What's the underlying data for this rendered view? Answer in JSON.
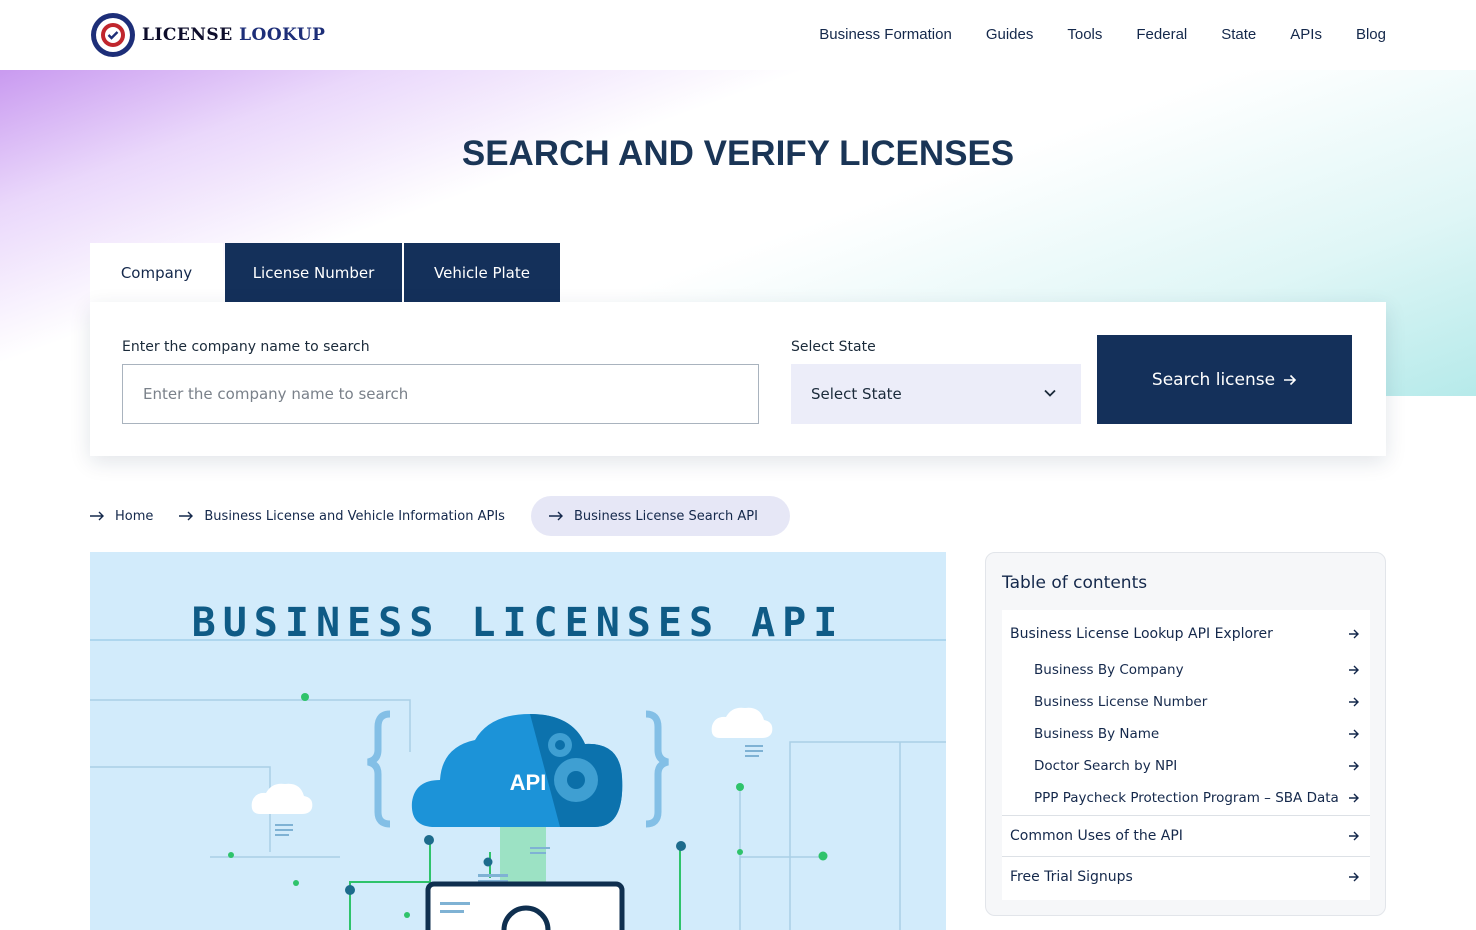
{
  "header": {
    "logo_word1": "LICENSE",
    "logo_word2": "LOOKUP",
    "nav": [
      "Business Formation",
      "Guides",
      "Tools",
      "Federal",
      "State",
      "APIs",
      "Blog"
    ]
  },
  "hero": {
    "title": "SEARCH AND VERIFY LICENSES"
  },
  "tabs": [
    "Company",
    "License Number",
    "Vehicle Plate"
  ],
  "search": {
    "company_label": "Enter the company name to search",
    "company_placeholder": "Enter the company name to search",
    "state_label": "Select State",
    "state_value": "Select State",
    "button_label": "Search license"
  },
  "breadcrumb": [
    "Home",
    "Business License and Vehicle Information APIs",
    "Business License Search API"
  ],
  "banner": {
    "title": "BUSINESS LICENSES API",
    "cloud_label": "API"
  },
  "toc": {
    "title": "Table of contents",
    "items": [
      "Business License Lookup API Explorer",
      "Business By Company",
      "Business License Number",
      "Business By Name",
      "Doctor Search by NPI",
      "PPP Paycheck Protection Program – SBA Data",
      "Common Uses of the API",
      "Free Trial Signups"
    ]
  },
  "colors": {
    "navy": "#14305a",
    "text": "#14284b",
    "select_bg": "#ecedf9",
    "banner_bg": "#d2ebfb"
  }
}
